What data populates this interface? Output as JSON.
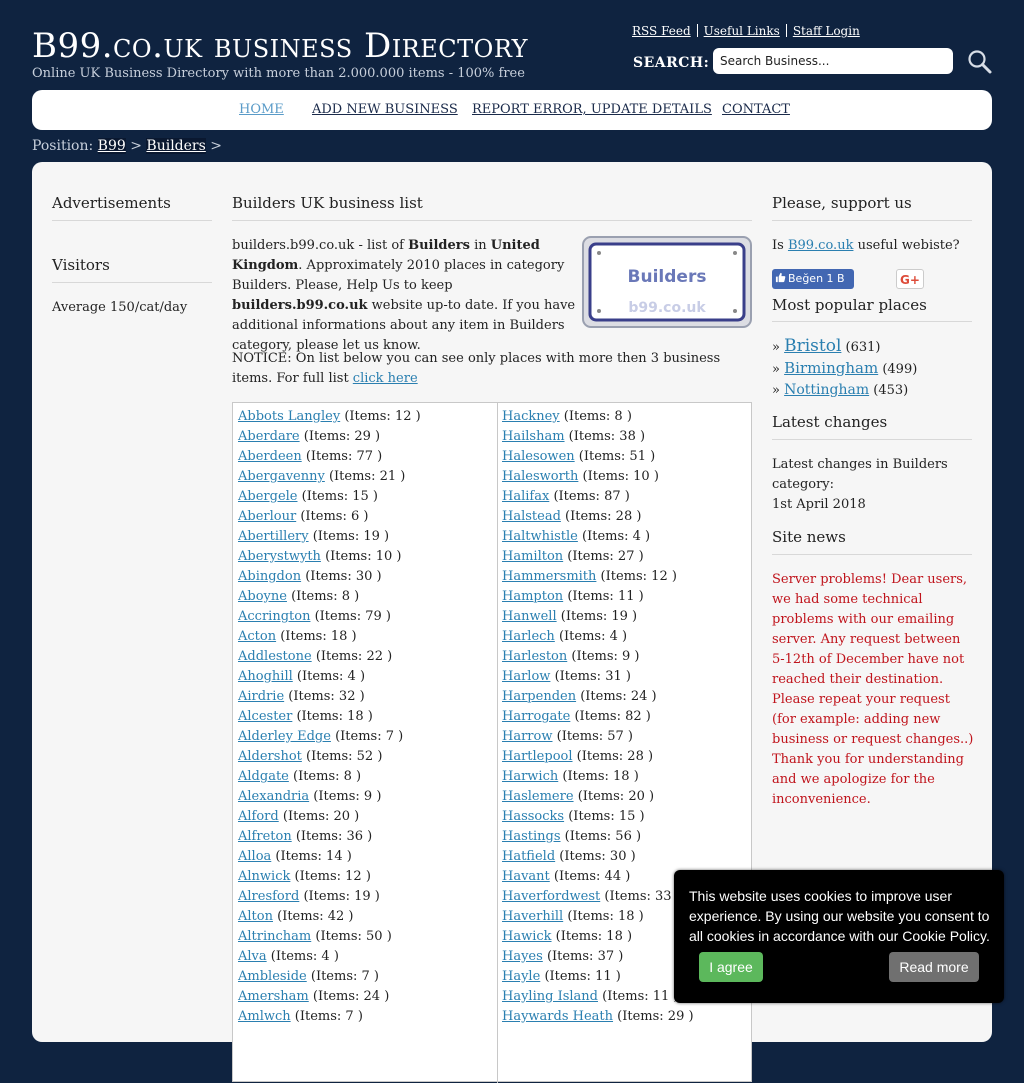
{
  "header": {
    "logo": "B99.co.uk business Directory",
    "tagline": "Online UK Business Directory with more than 2.000.000 items - 100% free",
    "links": [
      "RSS Feed",
      "Useful Links",
      "Staff Login"
    ],
    "search_label": "SEARCH:",
    "search_placeholder": "Search Business..."
  },
  "nav": {
    "items": [
      "HOME",
      "ADD NEW BUSINESS",
      "REPORT ERROR, UPDATE DETAILS",
      "CONTACT"
    ],
    "active": "HOME"
  },
  "breadcrumb": {
    "prefix": "Position:",
    "items": [
      "B99",
      "Builders"
    ],
    "sep": ">"
  },
  "left": {
    "ads_title": "Advertisements",
    "visitors_title": "Visitors",
    "visitors_text": "Average 150/cat/day"
  },
  "main": {
    "title": "Builders UK business list",
    "intro": {
      "site": "builders.b99.co.uk",
      "t1": " - list of ",
      "category": "Builders",
      "t2": " in ",
      "country": "United Kingdom",
      "t3": ". Approximately 2010 places in category Builders. Please, Help Us to keep ",
      "domain": "builders.b99.co.uk",
      "t4": " website up-to date. If you have additional informations about any item in Builders category, please let us know."
    },
    "badge_title": "Builders",
    "badge_sub": "b99.co.uk",
    "notice": "NOTICE: On list below you can see only places with more then 3 business items. For full list ",
    "notice_link": "click here",
    "col1": [
      {
        "name": "Abbots Langley",
        "count": "(Items: 12 )"
      },
      {
        "name": "Aberdare",
        "count": "(Items: 29 )"
      },
      {
        "name": "Aberdeen",
        "count": "(Items: 77 )"
      },
      {
        "name": "Abergavenny",
        "count": "(Items: 21 )"
      },
      {
        "name": "Abergele",
        "count": "(Items: 15 )"
      },
      {
        "name": "Aberlour",
        "count": "(Items: 6 )"
      },
      {
        "name": "Abertillery",
        "count": "(Items: 19 )"
      },
      {
        "name": "Aberystwyth",
        "count": "(Items: 10 )"
      },
      {
        "name": "Abingdon",
        "count": "(Items: 30 )"
      },
      {
        "name": "Aboyne",
        "count": "(Items: 8 )"
      },
      {
        "name": "Accrington",
        "count": "(Items: 79 )"
      },
      {
        "name": "Acton",
        "count": "(Items: 18 )"
      },
      {
        "name": "Addlestone",
        "count": "(Items: 22 )"
      },
      {
        "name": "Ahoghill",
        "count": "(Items: 4 )"
      },
      {
        "name": "Airdrie",
        "count": "(Items: 32 )"
      },
      {
        "name": "Alcester",
        "count": "(Items: 18 )"
      },
      {
        "name": "Alderley Edge",
        "count": "(Items: 7 )"
      },
      {
        "name": "Aldershot",
        "count": "(Items: 52 )"
      },
      {
        "name": "Aldgate",
        "count": "(Items: 8 )"
      },
      {
        "name": "Alexandria",
        "count": "(Items: 9 )"
      },
      {
        "name": "Alford",
        "count": "(Items: 20 )"
      },
      {
        "name": "Alfreton",
        "count": "(Items: 36 )"
      },
      {
        "name": "Alloa",
        "count": "(Items: 14 )"
      },
      {
        "name": "Alnwick",
        "count": "(Items: 12 )"
      },
      {
        "name": "Alresford",
        "count": "(Items: 19 )"
      },
      {
        "name": "Alton",
        "count": "(Items: 42 )"
      },
      {
        "name": "Altrincham",
        "count": "(Items: 50 )"
      },
      {
        "name": "Alva",
        "count": "(Items: 4 )"
      },
      {
        "name": "Ambleside",
        "count": "(Items: 7 )"
      },
      {
        "name": "Amersham",
        "count": "(Items: 24 )"
      },
      {
        "name": "Amlwch",
        "count": "(Items: 7 )"
      }
    ],
    "col2": [
      {
        "name": "Hackney",
        "count": "(Items: 8 )"
      },
      {
        "name": "Hailsham",
        "count": "(Items: 38 )"
      },
      {
        "name": "Halesowen",
        "count": "(Items: 51 )"
      },
      {
        "name": "Halesworth",
        "count": "(Items: 10 )"
      },
      {
        "name": "Halifax",
        "count": "(Items: 87 )"
      },
      {
        "name": "Halstead",
        "count": "(Items: 28 )"
      },
      {
        "name": "Haltwhistle",
        "count": "(Items: 4 )"
      },
      {
        "name": "Hamilton",
        "count": "(Items: 27 )"
      },
      {
        "name": "Hammersmith",
        "count": "(Items: 12 )"
      },
      {
        "name": "Hampton",
        "count": "(Items: 11 )"
      },
      {
        "name": "Hanwell",
        "count": "(Items: 19 )"
      },
      {
        "name": "Harlech",
        "count": "(Items: 4 )"
      },
      {
        "name": "Harleston",
        "count": "(Items: 9 )"
      },
      {
        "name": "Harlow",
        "count": "(Items: 31 )"
      },
      {
        "name": "Harpenden",
        "count": "(Items: 24 )"
      },
      {
        "name": "Harrogate",
        "count": "(Items: 82 )"
      },
      {
        "name": "Harrow",
        "count": "(Items: 57 )"
      },
      {
        "name": "Hartlepool",
        "count": "(Items: 28 )"
      },
      {
        "name": "Harwich",
        "count": "(Items: 18 )"
      },
      {
        "name": "Haslemere",
        "count": "(Items: 20 )"
      },
      {
        "name": "Hassocks",
        "count": "(Items: 15 )"
      },
      {
        "name": "Hastings",
        "count": "(Items: 56 )"
      },
      {
        "name": "Hatfield",
        "count": "(Items: 30 )"
      },
      {
        "name": "Havant",
        "count": "(Items: 44 )"
      },
      {
        "name": "Haverfordwest",
        "count": "(Items: 33 )"
      },
      {
        "name": "Haverhill",
        "count": "(Items: 18 )"
      },
      {
        "name": "Hawick",
        "count": "(Items: 18 )"
      },
      {
        "name": "Hayes",
        "count": "(Items: 37 )"
      },
      {
        "name": "Hayle",
        "count": "(Items: 11 )"
      },
      {
        "name": "Hayling Island",
        "count": "(Items: 11 )"
      },
      {
        "name": "Haywards Heath",
        "count": "(Items: 29 )"
      }
    ]
  },
  "right": {
    "support_title": "Please, support us",
    "support_pre": "Is ",
    "support_link": "B99.co.uk",
    "support_post": " useful webiste?",
    "fb_label": "Beğen 1 B",
    "gplus_label": "G+",
    "popular_title": "Most popular places",
    "popular": [
      {
        "name": "Bristol",
        "count": "(631)"
      },
      {
        "name": "Birmingham",
        "count": "(499)"
      },
      {
        "name": "Nottingham",
        "count": "(453)"
      }
    ],
    "latest_title": "Latest changes",
    "latest_text": "Latest changes in Builders category:",
    "latest_date": "1st April 2018",
    "news_title": "Site news",
    "news_text": "Server problems! Dear users, we had some technical problems with our emailing server. Any request between 5-12th of December have not reached their destination. Please repeat your request (for example: adding new business or request changes..) Thank you for understanding and we apologize for the inconvenience."
  },
  "cookie": {
    "text": "This website uses cookies to improve user experience. By using our website you consent to all cookies in accordance with our Cookie Policy.",
    "agree": "I agree",
    "more": "Read more"
  },
  "colors": {
    "background": "#0f2340",
    "link": "#2a7fb0",
    "news": "#c0141c",
    "agree": "#5cb85c"
  }
}
